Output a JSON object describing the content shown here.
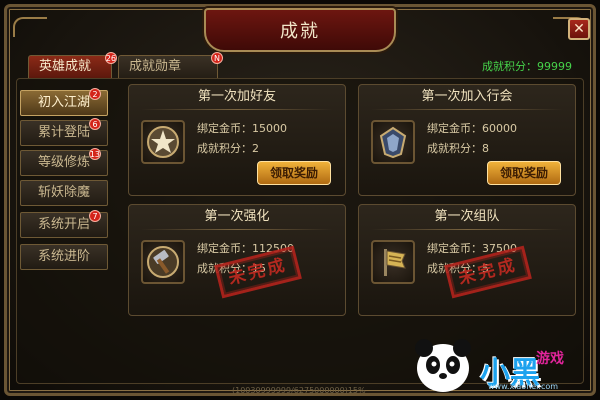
{
  "window": {
    "title": "成就",
    "close_label": "✕"
  },
  "tabs": [
    {
      "label": "英雄成就",
      "badge": "26",
      "active": true
    },
    {
      "label": "成就勋章",
      "badge": "N",
      "active": false
    }
  ],
  "score": {
    "label": "成就积分：",
    "value": "99999"
  },
  "sidebar": {
    "items": [
      {
        "label": "初入江湖",
        "badge": "2",
        "active": true
      },
      {
        "label": "累计登陆",
        "badge": "6",
        "active": false
      },
      {
        "label": "等级修炼",
        "badge": "13",
        "active": false
      },
      {
        "label": "斩妖除魔",
        "badge": "",
        "active": false
      },
      {
        "label": "系统开启",
        "badge": "7",
        "active": false
      },
      {
        "label": "系统进阶",
        "badge": "",
        "active": false
      }
    ]
  },
  "cards": [
    {
      "title": "第一次加好友",
      "gold_label": "绑定金币：",
      "gold": "15000",
      "points_label": "成就积分：",
      "points": "2",
      "icon": "star-medal-icon",
      "button": "领取奖励",
      "status": "claimable"
    },
    {
      "title": "第一次加入行会",
      "gold_label": "绑定金币：",
      "gold": "60000",
      "points_label": "成就积分：",
      "points": "8",
      "icon": "guild-crest-icon",
      "button": "领取奖励",
      "status": "claimable"
    },
    {
      "title": "第一次强化",
      "gold_label": "绑定金币：",
      "gold": "112500",
      "points_label": "成就积分：",
      "points": "15",
      "icon": "hammer-icon",
      "stamp": "未完成",
      "status": "incomplete"
    },
    {
      "title": "第一次组队",
      "gold_label": "绑定金币：",
      "gold": "37500",
      "points_label": "成就积分：",
      "points": "5",
      "icon": "flag-icon",
      "stamp": "未完成",
      "status": "incomplete"
    }
  ],
  "footer": {
    "text": "(10030999999/6275000000)15%"
  },
  "watermark": {
    "text": "小黑",
    "text2": "游戏",
    "url": "www.xiaohei.com"
  },
  "colors": {
    "accent_gold": "#f0b23a",
    "title_red": "#6d1610",
    "score_green": "#46d24a",
    "stamp_red": "#b2231c"
  }
}
